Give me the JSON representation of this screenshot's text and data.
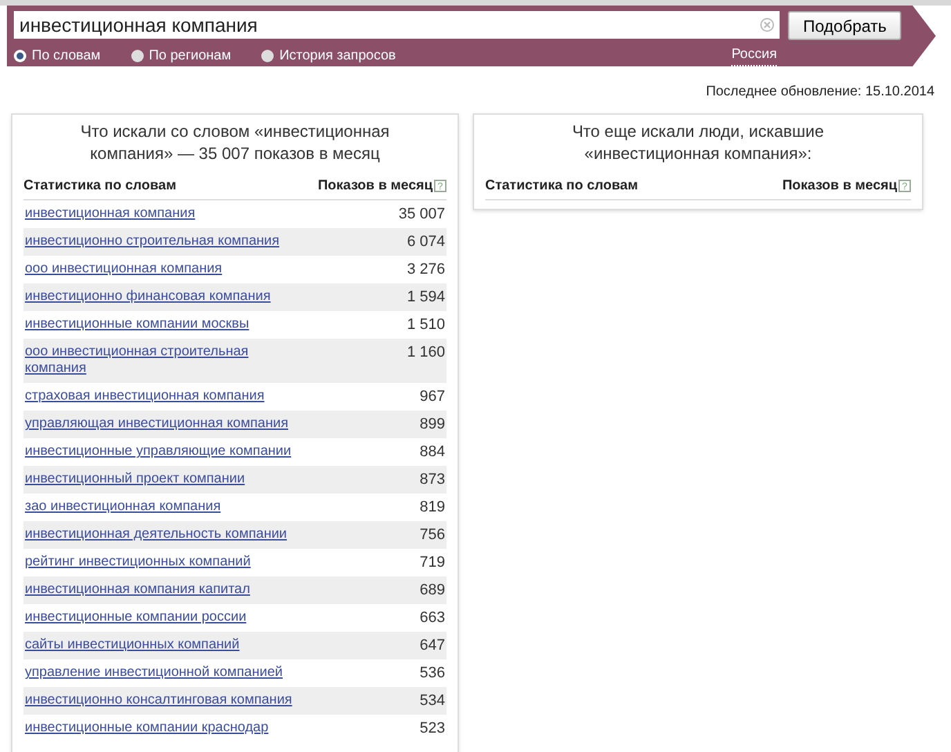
{
  "search": {
    "value": "инвестиционная компания",
    "button": "Подобрать"
  },
  "modes": [
    {
      "label": "По словам",
      "selected": true
    },
    {
      "label": "По регионам",
      "selected": false
    },
    {
      "label": "История запросов",
      "selected": false
    }
  ],
  "region": "Россия",
  "last_update": "Последнее обновление: 15.10.2014",
  "left_panel": {
    "title": "Что искали со словом «инвестиционная компания» — 35 007 показов в месяц",
    "columns": [
      "Статистика по словам",
      "Показов в месяц"
    ],
    "help_icon": "?",
    "rows": [
      {
        "phrase": "инвестиционная компания",
        "count": "35 007"
      },
      {
        "phrase": "инвестиционно строительная компания",
        "count": "6 074"
      },
      {
        "phrase": "ооо инвестиционная компания",
        "count": "3 276"
      },
      {
        "phrase": "инвестиционно финансовая компания",
        "count": "1 594"
      },
      {
        "phrase": "инвестиционные компании москвы",
        "count": "1 510"
      },
      {
        "phrase": "ооо инвестиционная строительная компания",
        "count": "1 160"
      },
      {
        "phrase": "страховая инвестиционная компания",
        "count": "967"
      },
      {
        "phrase": "управляющая инвестиционная компания",
        "count": "899"
      },
      {
        "phrase": "инвестиционные управляющие компании",
        "count": "884"
      },
      {
        "phrase": "инвестиционный проект компании",
        "count": "873"
      },
      {
        "phrase": "зао инвестиционная компания",
        "count": "819"
      },
      {
        "phrase": "инвестиционная деятельность компании",
        "count": "756"
      },
      {
        "phrase": "рейтинг инвестиционных компаний",
        "count": "719"
      },
      {
        "phrase": "инвестиционная компания капитал",
        "count": "689"
      },
      {
        "phrase": "инвестиционные компании россии",
        "count": "663"
      },
      {
        "phrase": "сайты инвестиционных компаний",
        "count": "647"
      },
      {
        "phrase": "управление инвестиционной компанией",
        "count": "536"
      },
      {
        "phrase": "инвестиционно консалтинговая компания",
        "count": "534"
      },
      {
        "phrase": "инвестиционные компании краснодар",
        "count": "523"
      }
    ]
  },
  "right_panel": {
    "title": "Что еще искали люди, искавшие «инвестиционная компания»:",
    "columns": [
      "Статистика по словам",
      "Показов в месяц"
    ],
    "help_icon": "?"
  }
}
